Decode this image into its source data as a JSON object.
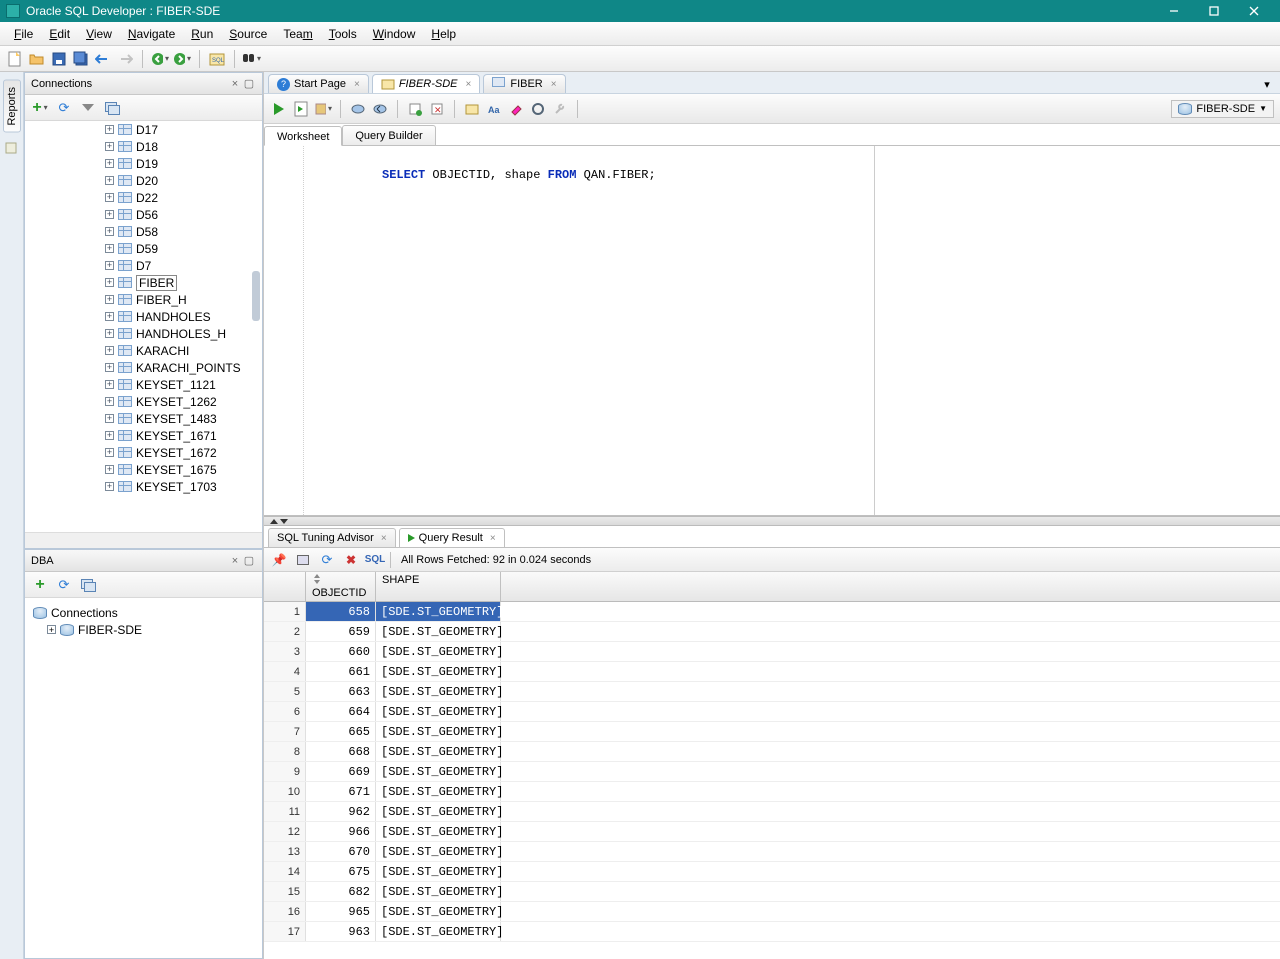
{
  "titlebar": {
    "text": "Oracle SQL Developer : FIBER-SDE"
  },
  "menus": {
    "file": "File",
    "edit": "Edit",
    "view": "View",
    "navigate": "Navigate",
    "run": "Run",
    "source": "Source",
    "team": "Team",
    "tools": "Tools",
    "window": "Window",
    "help": "Help"
  },
  "connections": {
    "title": "Connections",
    "items": [
      "D17",
      "D18",
      "D19",
      "D20",
      "D22",
      "D56",
      "D58",
      "D59",
      "D7",
      "FIBER",
      "FIBER_H",
      "HANDHOLES",
      "HANDHOLES_H",
      "KARACHI",
      "KARACHI_POINTS",
      "KEYSET_1121",
      "KEYSET_1262",
      "KEYSET_1483",
      "KEYSET_1671",
      "KEYSET_1672",
      "KEYSET_1675",
      "KEYSET_1703"
    ],
    "selected": "FIBER"
  },
  "dba": {
    "title": "DBA",
    "root": "Connections",
    "child": "FIBER-SDE"
  },
  "editorTabs": {
    "start": "Start Page",
    "sde": "FIBER-SDE",
    "fiber": "FIBER"
  },
  "connDD": "FIBER-SDE",
  "wsTabs": {
    "worksheet": "Worksheet",
    "qb": "Query Builder"
  },
  "sql": {
    "select": "SELECT",
    "mid": " OBJECTID, shape ",
    "from": "FROM",
    "tail": " QAN.FIBER;"
  },
  "resultTabs": {
    "advisor": "SQL Tuning Advisor",
    "qr": "Query Result"
  },
  "status": "All Rows Fetched: 92 in 0.024 seconds",
  "sqlLabel": "SQL",
  "gridHeaders": {
    "objectid": "OBJECTID",
    "shape": "SHAPE"
  },
  "rows": [
    {
      "n": 1,
      "oid": 658,
      "shape": "[SDE.ST_GEOMETRY]"
    },
    {
      "n": 2,
      "oid": 659,
      "shape": "[SDE.ST_GEOMETRY]"
    },
    {
      "n": 3,
      "oid": 660,
      "shape": "[SDE.ST_GEOMETRY]"
    },
    {
      "n": 4,
      "oid": 661,
      "shape": "[SDE.ST_GEOMETRY]"
    },
    {
      "n": 5,
      "oid": 663,
      "shape": "[SDE.ST_GEOMETRY]"
    },
    {
      "n": 6,
      "oid": 664,
      "shape": "[SDE.ST_GEOMETRY]"
    },
    {
      "n": 7,
      "oid": 665,
      "shape": "[SDE.ST_GEOMETRY]"
    },
    {
      "n": 8,
      "oid": 668,
      "shape": "[SDE.ST_GEOMETRY]"
    },
    {
      "n": 9,
      "oid": 669,
      "shape": "[SDE.ST_GEOMETRY]"
    },
    {
      "n": 10,
      "oid": 671,
      "shape": "[SDE.ST_GEOMETRY]"
    },
    {
      "n": 11,
      "oid": 962,
      "shape": "[SDE.ST_GEOMETRY]"
    },
    {
      "n": 12,
      "oid": 966,
      "shape": "[SDE.ST_GEOMETRY]"
    },
    {
      "n": 13,
      "oid": 670,
      "shape": "[SDE.ST_GEOMETRY]"
    },
    {
      "n": 14,
      "oid": 675,
      "shape": "[SDE.ST_GEOMETRY]"
    },
    {
      "n": 15,
      "oid": 682,
      "shape": "[SDE.ST_GEOMETRY]"
    },
    {
      "n": 16,
      "oid": 965,
      "shape": "[SDE.ST_GEOMETRY]"
    },
    {
      "n": 17,
      "oid": 963,
      "shape": "[SDE.ST_GEOMETRY]"
    }
  ]
}
